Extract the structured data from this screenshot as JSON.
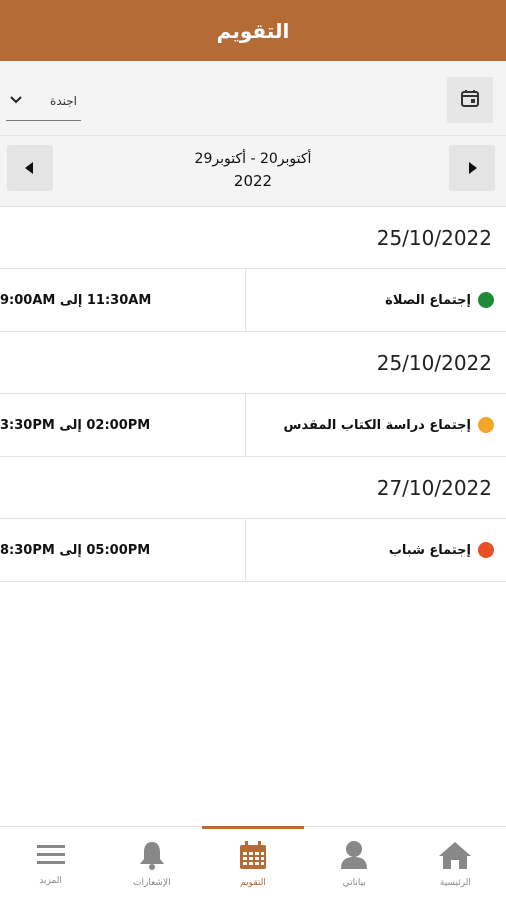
{
  "app_bar": {
    "title": "التقويم"
  },
  "filter": {
    "view_select_value": "اجندة",
    "icons": {
      "dropdown": "chevron-down-icon",
      "calendar": "calendar-icon"
    }
  },
  "range": {
    "dates": "أكتوبر20  -  أكتوبر29",
    "year": "2022",
    "icons": {
      "prev": "triangle-left-icon",
      "next": "triangle-right-icon"
    }
  },
  "agenda": [
    {
      "date": "25/10/2022",
      "time": "11:30AM إلى 9:00AM",
      "title": "إجتماع الصلاة",
      "color": "#1f8b3a"
    },
    {
      "date": "25/10/2022",
      "time": "02:00PM إلى 3:30PM",
      "title": "إجتماع دراسة الكتاب المقدس",
      "color": "#f3a628"
    },
    {
      "date": "27/10/2022",
      "time": "05:00PM إلى 8:30PM",
      "title": "إجتماع شباب",
      "color": "#e94e24"
    }
  ],
  "bottom_nav": [
    {
      "label": "المزيد",
      "icon": "menu-icon",
      "active": false
    },
    {
      "label": "الإشعارات",
      "icon": "bell-icon",
      "active": false
    },
    {
      "label": "التقويم",
      "icon": "calendar-icon",
      "active": true
    },
    {
      "label": "بياناتي",
      "icon": "user-icon",
      "active": false
    },
    {
      "label": "الرئيسية",
      "icon": "home-icon",
      "active": false
    }
  ],
  "colors": {
    "brand": "#b46b35"
  }
}
